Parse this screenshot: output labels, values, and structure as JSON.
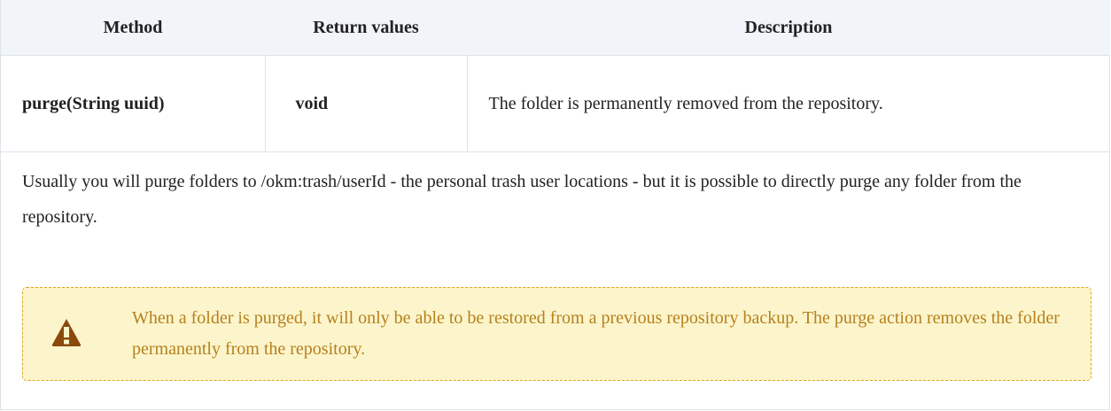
{
  "table": {
    "headers": [
      "Method",
      "Return values",
      "Description"
    ],
    "row": {
      "method": "purge(String uuid)",
      "return_value": "void",
      "description": "The folder is permanently removed from the repository."
    }
  },
  "paragraph": "Usually you will purge folders to /okm:trash/userId - the personal trash user locations - but it is possible to directly purge any folder from the repository.",
  "warning": {
    "icon": "warning-triangle-icon",
    "text": "When a folder is purged, it will only be able to be restored from a previous repository backup. The purge action removes the folder permanently from the repository.",
    "colors": {
      "background": "#fcf5cb",
      "border": "#d9a820",
      "text": "#b6801f",
      "icon": "#8a4a0c"
    }
  },
  "colors": {
    "header_background": "#f1f4f8",
    "border": "#dde3ea",
    "text": "#222222"
  }
}
